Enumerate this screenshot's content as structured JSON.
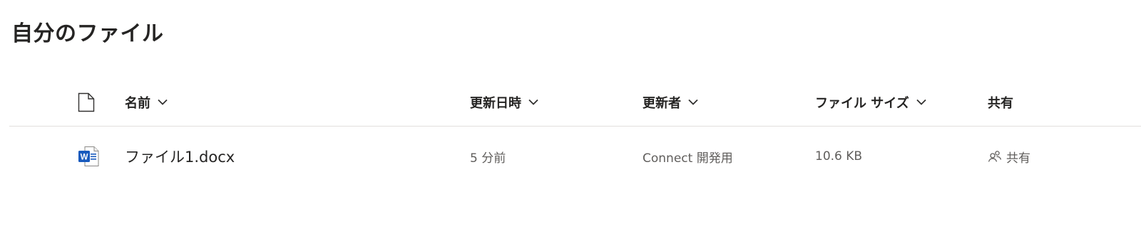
{
  "page": {
    "title": "自分のファイル"
  },
  "columns": {
    "name": "名前",
    "modified": "更新日時",
    "modified_by": "更新者",
    "file_size": "ファイル サイズ",
    "sharing": "共有"
  },
  "files": [
    {
      "name": "ファイル1.docx",
      "icon": "word-document-icon",
      "modified": "5 分前",
      "modified_by": "Connect 開発用",
      "file_size": "10.6 KB",
      "sharing": "共有",
      "sharing_icon": "shared-people-icon"
    }
  ],
  "colors": {
    "word_blue": "#185abd",
    "text_primary": "#252423",
    "text_secondary": "#605e5c",
    "divider": "#e1dfdd"
  }
}
